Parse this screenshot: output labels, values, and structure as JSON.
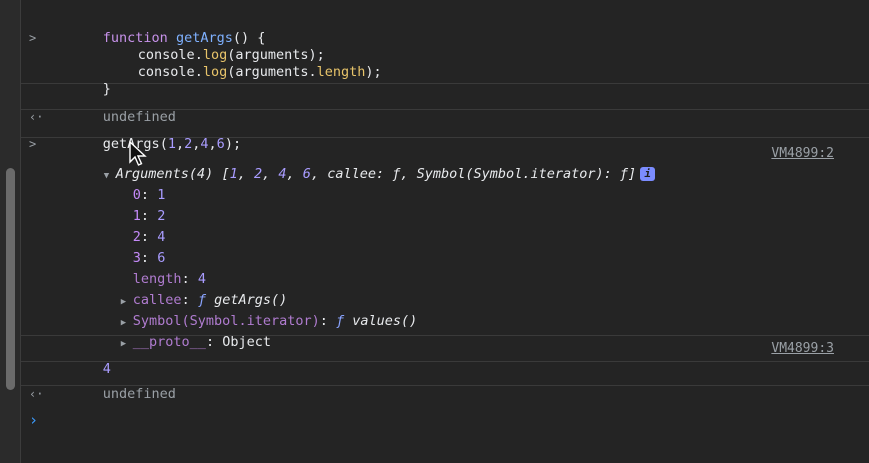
{
  "console": {
    "entry1": {
      "code_lines": [
        {
          "kw": "function",
          "name": "getArgs",
          "rest": "() {"
        },
        {
          "obj": "console",
          "dot": ".",
          "method": "log",
          "args": "(arguments);"
        },
        {
          "obj": "console",
          "dot": ".",
          "method": "log",
          "args_open": "(arguments.",
          "prop": "length",
          "args_close": ");"
        },
        {
          "text": "}"
        }
      ]
    },
    "result1": "undefined",
    "entry2": {
      "call": "getArgs",
      "args_open": "(",
      "args": [
        "1",
        "2",
        "4",
        "6"
      ],
      "args_close": ");"
    },
    "log1": {
      "summary": {
        "label": "Arguments(4) [",
        "values": [
          "1",
          "2",
          "4",
          "6"
        ],
        "callee_key": "callee",
        "callee_val": "ƒ",
        "symbol_key": "Symbol(Symbol.iterator)",
        "symbol_val": "ƒ",
        "close": "]",
        "info": "i"
      },
      "source": "VM4899:2",
      "props": [
        {
          "key": "0",
          "val": "1"
        },
        {
          "key": "1",
          "val": "2"
        },
        {
          "key": "2",
          "val": "4"
        },
        {
          "key": "3",
          "val": "6"
        }
      ],
      "length_key": "length",
      "length_val": "4",
      "callee_key": "callee",
      "callee_f": "ƒ",
      "callee_name": "getArgs()",
      "iter_key": "Symbol(Symbol.iterator)",
      "iter_f": "ƒ",
      "iter_name": "values()",
      "proto_key": "__proto__",
      "proto_val": "Object"
    },
    "log2": {
      "value": "4",
      "source": "VM4899:3"
    },
    "result2": "undefined",
    "prompt_symbol": "›",
    "input_symbol": ">",
    "output_symbol": "‹·"
  }
}
